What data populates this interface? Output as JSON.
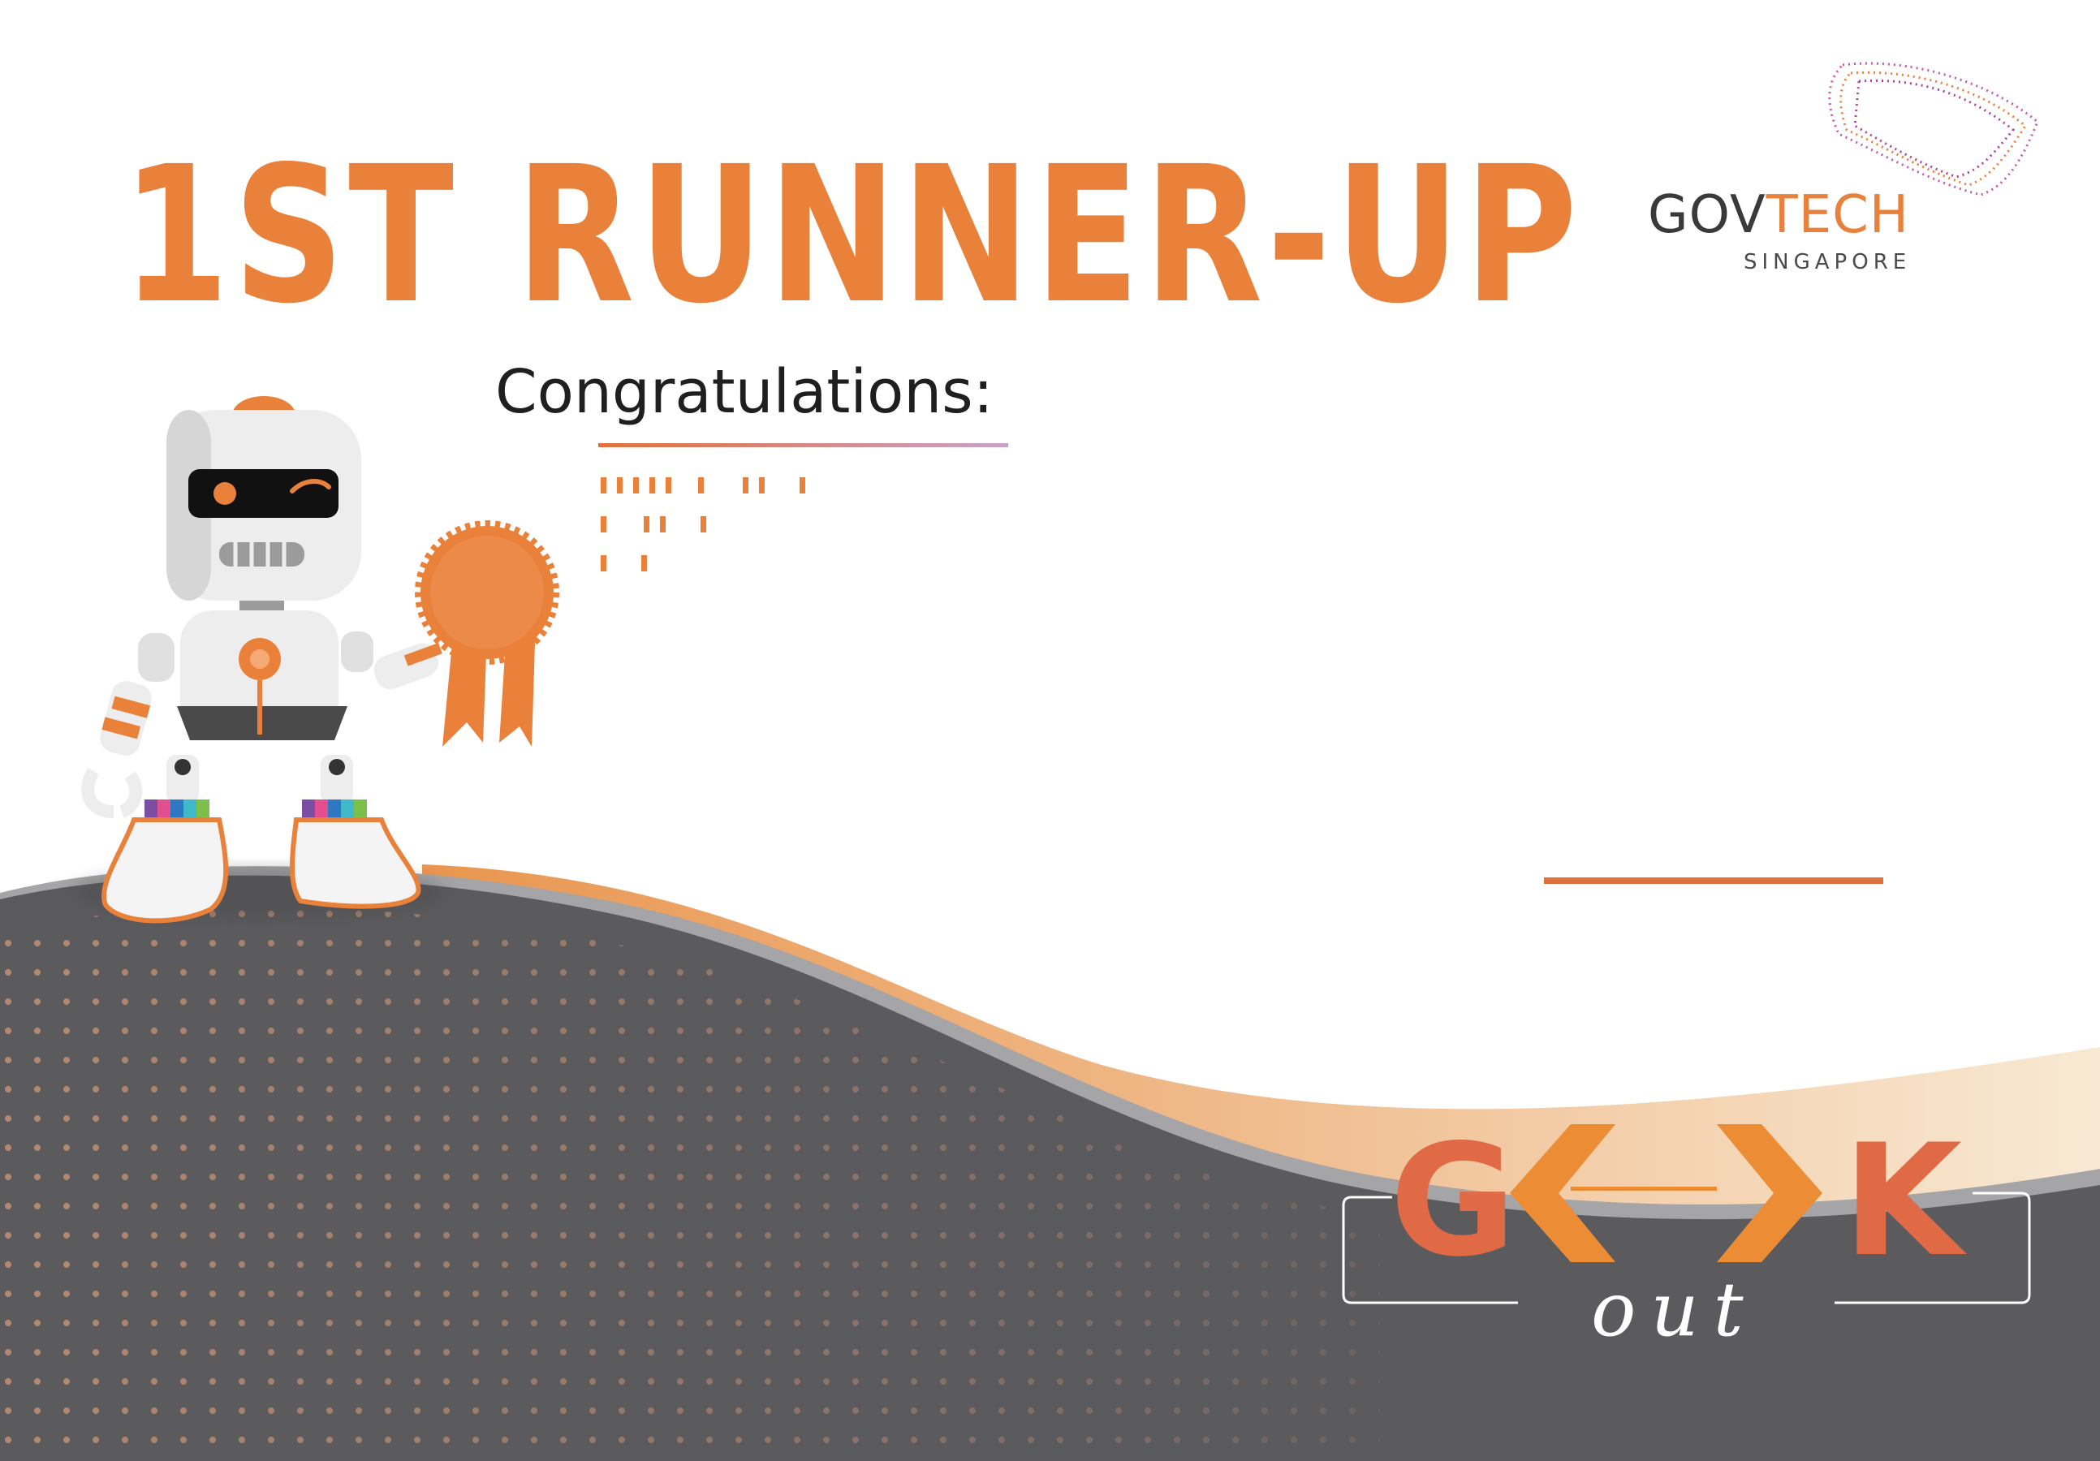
{
  "certificate": {
    "title": "1ST RUNNER-UP",
    "greeting": "Congratulations:",
    "colors": {
      "accent": "#e9813b",
      "dark_ground": "#5b5a5d",
      "peach_wave": "#ebb686",
      "text_dark": "#1f1f1f"
    }
  },
  "logo": {
    "word_left": "GOV",
    "word_right": "TECH",
    "sub": "SINGAPORE"
  },
  "event_logo": {
    "text": "GEEK",
    "sub": "out"
  },
  "illustration": {
    "robot": "robot-mascot-icon",
    "ribbon": "award-rosette-icon"
  }
}
